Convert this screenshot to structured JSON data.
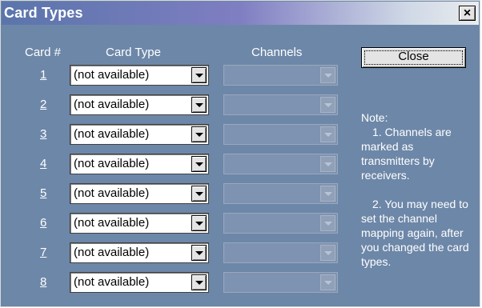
{
  "window": {
    "title": "Card Types",
    "close_glyph": "×"
  },
  "headers": {
    "card_num": "Card #",
    "card_type": "Card Type",
    "channels": "Channels"
  },
  "close_button": {
    "label": "Close"
  },
  "rows": [
    {
      "num": "1",
      "card_type": "(not available)",
      "channels": ""
    },
    {
      "num": "2",
      "card_type": "(not available)",
      "channels": ""
    },
    {
      "num": "3",
      "card_type": "(not available)",
      "channels": ""
    },
    {
      "num": "4",
      "card_type": "(not available)",
      "channels": ""
    },
    {
      "num": "5",
      "card_type": "(not available)",
      "channels": ""
    },
    {
      "num": "6",
      "card_type": "(not available)",
      "channels": ""
    },
    {
      "num": "7",
      "card_type": "(not available)",
      "channels": ""
    },
    {
      "num": "8",
      "card_type": "(not available)",
      "channels": ""
    }
  ],
  "note": {
    "heading": "Note:",
    "item1": "1. Channels are marked as transmitters by receivers.",
    "item2": "2. You may need to set the channel mapping again, after you changed the card types."
  },
  "colors": {
    "dialog_bg": "#6d87a8",
    "title_start": "#5a75ab",
    "title_end": "#e9ecef"
  }
}
